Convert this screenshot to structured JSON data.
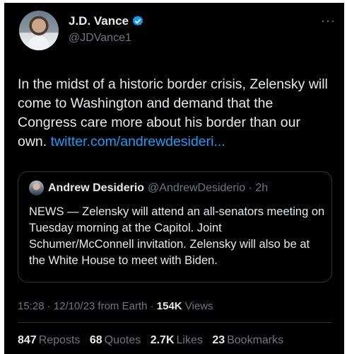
{
  "author": {
    "name": "J.D. Vance",
    "handle": "@JDVance1",
    "verified_color": "#1d9bf0"
  },
  "more_icon": "more-horizontal-icon",
  "tweet": {
    "text": "In the midst of a historic border crisis, Zelensky will come to Washington and demand that the Congress care more about his border than our own.",
    "link": "twitter.com/andrewdesideri..."
  },
  "quote": {
    "name": "Andrew Desiderio",
    "handle_time": "@AndrewDesiderio · 2h",
    "text": "NEWS — Zelensky will attend an all-senators meeting on Tuesday morning at the Capitol. Joint Schumer/McConnell invitation. Zelensky will also be at the White House to meet with Biden."
  },
  "meta": {
    "timestamp": "15:28 · 12/10/23 from Earth · ",
    "views_count": "154K",
    "views_label": " Views"
  },
  "stats": {
    "reposts_count": "847",
    "reposts_label": "Reposts",
    "quotes_count": "68",
    "quotes_label": "Quotes",
    "likes_count": "2.7K",
    "likes_label": "Likes",
    "bookmarks_count": "23",
    "bookmarks_label": "Bookmarks"
  },
  "colors": {
    "background": "#000000",
    "text": "#e7e9ea",
    "muted": "#71767b",
    "link": "#1d9bf0",
    "border": "#2f3336"
  }
}
